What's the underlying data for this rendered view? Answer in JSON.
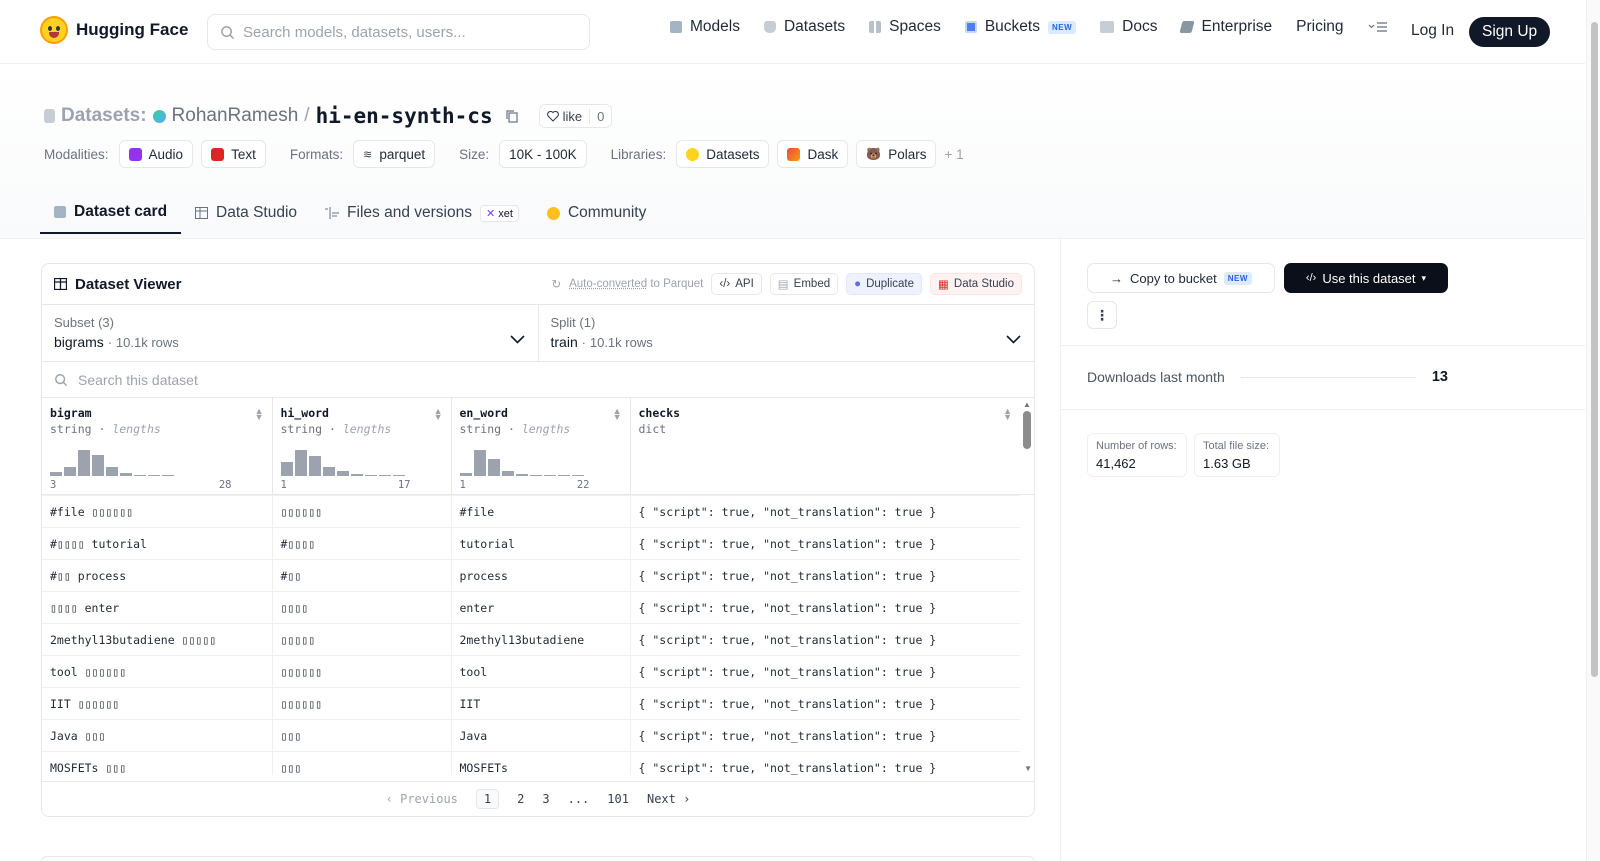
{
  "nav": {
    "brand": "Hugging Face",
    "search_placeholder": "Search models, datasets, users...",
    "links": [
      "Models",
      "Datasets",
      "Spaces",
      "Buckets",
      "Docs",
      "Enterprise",
      "Pricing"
    ],
    "buckets_badge": "NEW",
    "login": "Log In",
    "signup": "Sign Up"
  },
  "header": {
    "section": "Datasets:",
    "user": "RohanRamesh",
    "separator": "/",
    "repo": "hi-en-synth-cs",
    "like_label": "like",
    "like_count": "0",
    "modalities_label": "Modalities:",
    "modalities": [
      "Audio",
      "Text"
    ],
    "formats_label": "Formats:",
    "formats": [
      "parquet"
    ],
    "size_label": "Size:",
    "size": "10K - 100K",
    "libraries_label": "Libraries:",
    "libraries": [
      "Datasets",
      "Dask",
      "Polars"
    ],
    "libraries_more": "+ 1"
  },
  "tabs": {
    "card": "Dataset card",
    "studio": "Data Studio",
    "files": "Files and versions",
    "xet": "xet",
    "community": "Community"
  },
  "viewer": {
    "title": "Dataset Viewer",
    "auto_converted": "Auto-converted",
    "to_parquet": "to Parquet",
    "api": "API",
    "embed": "Embed",
    "duplicate": "Duplicate",
    "data_studio": "Data Studio",
    "subset_label": "Subset (3)",
    "subset_value": "bigrams",
    "subset_rows": "10.1k rows",
    "split_label": "Split (1)",
    "split_value": "train",
    "split_rows": "10.1k rows",
    "search_placeholder": "Search this dataset",
    "columns": [
      {
        "name": "bigram",
        "type": "string",
        "stat": "lengths",
        "min": "3",
        "max": "28",
        "hist": [
          0.12,
          0.3,
          0.85,
          0.7,
          0.3,
          0.1,
          0.04,
          0.03,
          0.02
        ]
      },
      {
        "name": "hi_word",
        "type": "string",
        "stat": "lengths",
        "min": "1",
        "max": "17",
        "hist": [
          0.45,
          0.85,
          0.65,
          0.3,
          0.15,
          0.05,
          0.03,
          0.02,
          0.02
        ]
      },
      {
        "name": "en_word",
        "type": "string",
        "stat": "lengths",
        "min": "1",
        "max": "22",
        "hist": [
          0.1,
          0.85,
          0.55,
          0.15,
          0.05,
          0.03,
          0.02,
          0.02,
          0.0
        ]
      },
      {
        "name": "checks",
        "type": "dict",
        "stat": "",
        "min": "",
        "max": "",
        "hist": []
      }
    ],
    "rows": [
      [
        "#file ▯▯▯▯▯▯",
        "▯▯▯▯▯▯",
        "#file",
        "{ \"script\": true, \"not_translation\": true }"
      ],
      [
        "#▯▯▯▯ tutorial",
        "#▯▯▯▯",
        "tutorial",
        "{ \"script\": true, \"not_translation\": true }"
      ],
      [
        "#▯▯ process",
        "#▯▯",
        "process",
        "{ \"script\": true, \"not_translation\": true }"
      ],
      [
        "▯▯▯▯ enter",
        "▯▯▯▯",
        "enter",
        "{ \"script\": true, \"not_translation\": true }"
      ],
      [
        "2methyl13butadiene ▯▯▯▯▯",
        "▯▯▯▯▯",
        "2methyl13butadiene",
        "{ \"script\": true, \"not_translation\": true }"
      ],
      [
        "tool ▯▯▯▯▯▯",
        "▯▯▯▯▯▯",
        "tool",
        "{ \"script\": true, \"not_translation\": true }"
      ],
      [
        "IIT ▯▯▯▯▯▯",
        "▯▯▯▯▯▯",
        "IIT",
        "{ \"script\": true, \"not_translation\": true }"
      ],
      [
        "Java ▯▯▯",
        "▯▯▯",
        "Java",
        "{ \"script\": true, \"not_translation\": true }"
      ],
      [
        "MOSFETs ▯▯▯",
        "▯▯▯",
        "MOSFETs",
        "{ \"script\": true, \"not_translation\": true }"
      ]
    ],
    "pager": {
      "prev": "Previous",
      "pages": [
        "1",
        "2",
        "3",
        "...",
        "101"
      ],
      "next": "Next",
      "current": "1"
    }
  },
  "side": {
    "copy_bucket": "Copy to bucket",
    "copy_badge": "NEW",
    "use_dataset": "Use this dataset",
    "downloads_label": "Downloads last month",
    "downloads": "13",
    "rows_label": "Number of rows:",
    "rows_value": "41,462",
    "size_label": "Total file size:",
    "size_value": "1.63 GB"
  },
  "colors": {
    "accent": "#111827",
    "hist_bar": "#9ca3af",
    "logo": "#ffd21e"
  }
}
